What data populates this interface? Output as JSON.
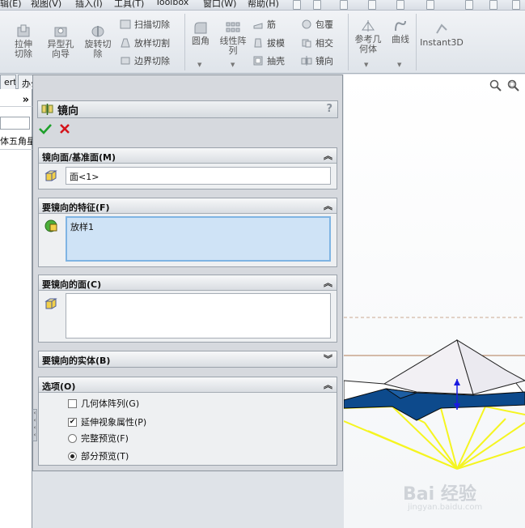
{
  "menubar": {
    "items": [
      "辑(E)",
      "视图(V)",
      "插入(I)",
      "工具(T)",
      "Toolbox",
      "窗口(W)",
      "帮助(H)"
    ]
  },
  "ribbon": {
    "extrude_cut": "拉伸切除",
    "hole_wizard": "异型孔向导",
    "revolve_cut": "旋转切除",
    "swept_cut": "扫描切除",
    "lofted_cut": "放样切割",
    "boundary_cut": "边界切除",
    "fillet": "圆角",
    "linear_pattern": "线性阵列",
    "rib": "筋",
    "draft": "拔模",
    "shell": "抽壳",
    "wrap": "包覆",
    "intersect": "相交",
    "mirror": "镜向",
    "reference_geometry": "参考几何体",
    "curves": "曲线",
    "instant3d": "Instant3D"
  },
  "tabs": [
    "ert",
    "办公室产品"
  ],
  "left": {
    "tree_text": "体五角星"
  },
  "pm": {
    "title": "镜向",
    "help": "?",
    "mirror_face": {
      "header": "镜向面/基准面(M)",
      "value": "面<1>"
    },
    "features": {
      "header": "要镜向的特征(F)",
      "value": "放样1"
    },
    "faces": {
      "header": "要镜向的面(C)",
      "value": ""
    },
    "bodies": {
      "header": "要镜向的实体(B)"
    },
    "options": {
      "header": "选项(O)",
      "geometry_pattern": "几何体阵列(G)",
      "propagate_visual": "延伸视象属性(P)",
      "full_preview": "完整预览(F)",
      "partial_preview": "部分预览(T)",
      "geometry_pattern_checked": false,
      "propagate_visual_checked": true,
      "preview_mode": "partial"
    }
  },
  "watermark": {
    "brand": "Bai 经验",
    "url": "jingyan.baidu.com"
  },
  "colors": {
    "ok": "#1ea02b",
    "cancel": "#d4141b",
    "selected_field": "#cfe3f6",
    "model_blue": "#0d4a8c",
    "preview_yellow": "#f5f520"
  }
}
